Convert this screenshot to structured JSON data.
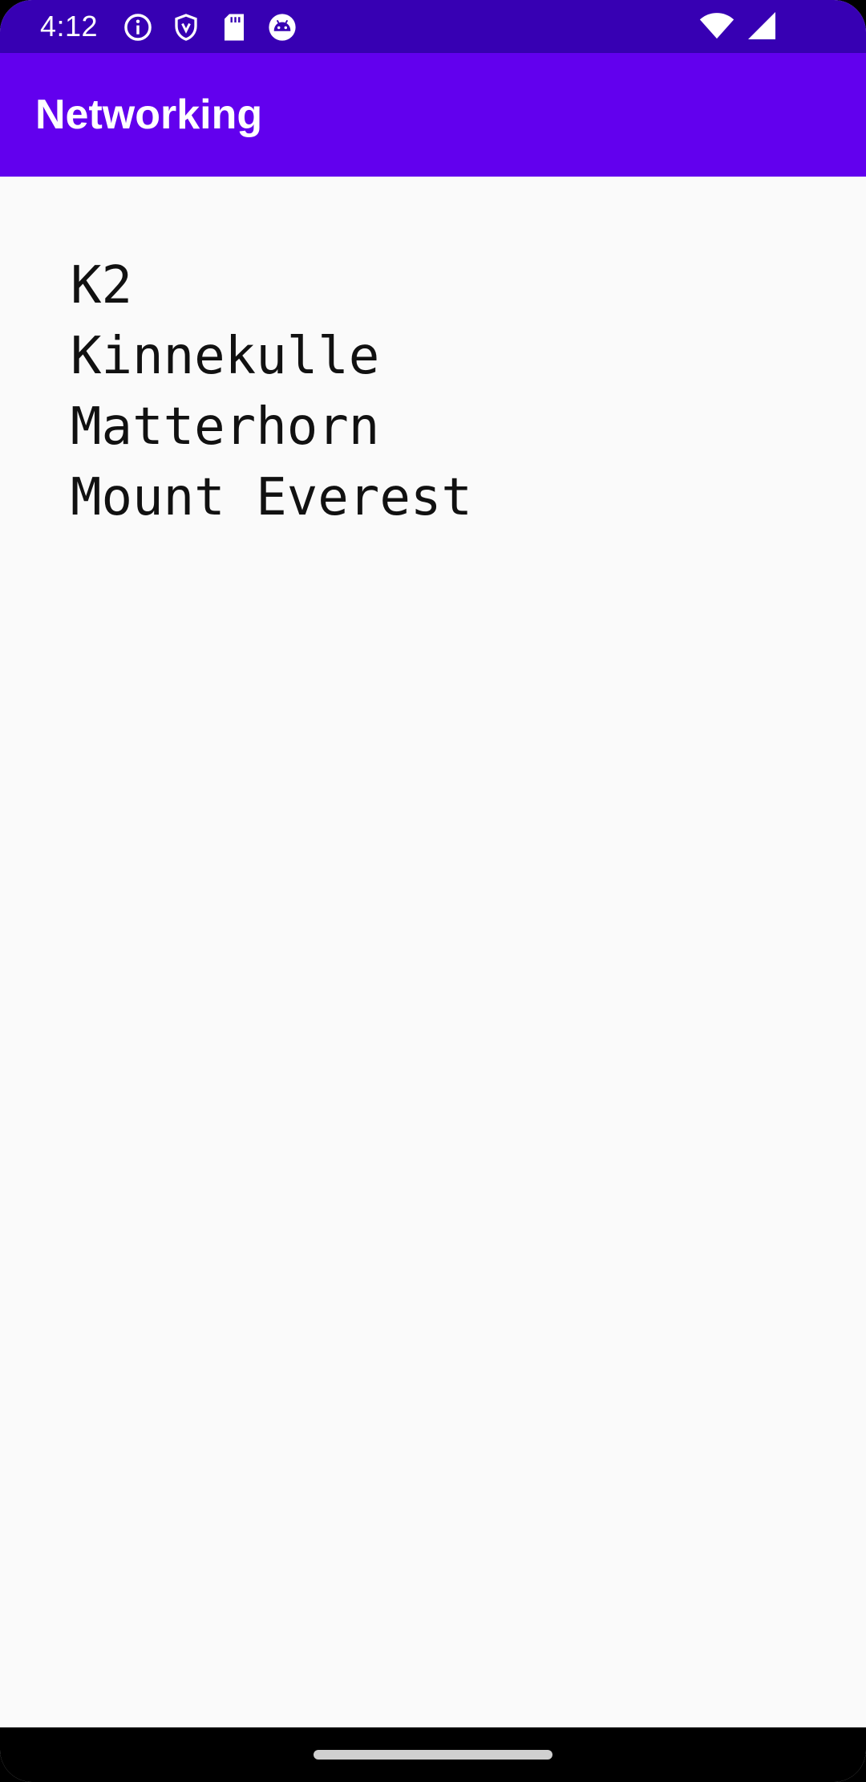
{
  "status_bar": {
    "time": "4:12",
    "left_icons": [
      "info-icon",
      "shield-icon",
      "sd-card-icon",
      "android-debug-icon"
    ],
    "right_icons": [
      "wifi-icon",
      "cell-signal-icon"
    ],
    "background_color": "#3700b3"
  },
  "app_bar": {
    "title": "Networking",
    "background_color": "#6200ee"
  },
  "mountains": [
    "K2",
    "Kinnekulle",
    "Matterhorn",
    "Mount Everest"
  ],
  "nav_bar": {
    "home_indicator": "home-handle"
  }
}
